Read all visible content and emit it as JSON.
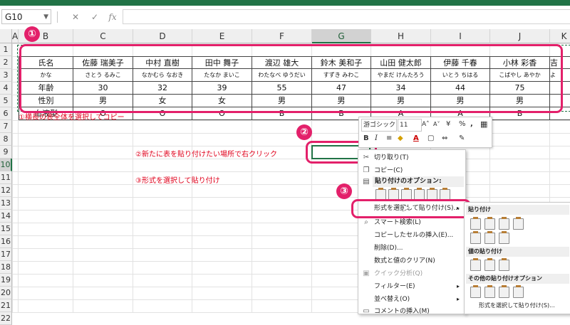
{
  "formula_bar": {
    "name_box": "G10",
    "cancel": "✕",
    "enter": "✓",
    "fx": "fx"
  },
  "columns": [
    "A",
    "B",
    "C",
    "D",
    "E",
    "F",
    "G",
    "H",
    "I",
    "J",
    "K"
  ],
  "rows": [
    "1",
    "2",
    "3",
    "4",
    "5",
    "6",
    "7",
    "8",
    "9",
    "10",
    "11",
    "12",
    "13",
    "14",
    "15",
    "16",
    "17",
    "18",
    "19",
    "20",
    "21",
    "22"
  ],
  "table": [
    [
      "氏名",
      "佐藤 瑞美子",
      "中村 直樹",
      "田中 舞子",
      "渡辺 雄大",
      "鈴木 美和子",
      "山田 健太郎",
      "伊藤 千春",
      "小林 彩香",
      "吉"
    ],
    [
      "かな",
      "さとう るみこ",
      "なかむら なおき",
      "たなか まいこ",
      "わたなべ ゆうだい",
      "すずき みわこ",
      "やまだ けんたろう",
      "いとう ちはる",
      "こばやし あやか",
      "よ"
    ],
    [
      "年齢",
      "30",
      "32",
      "39",
      "55",
      "47",
      "34",
      "44",
      "75",
      ""
    ],
    [
      "性別",
      "男",
      "女",
      "女",
      "男",
      "男",
      "男",
      "男",
      "男",
      ""
    ],
    [
      "血液型",
      "O",
      "O",
      "O",
      "B",
      "B",
      "A",
      "A",
      "B",
      ""
    ]
  ],
  "steps": {
    "n1": "①",
    "n2": "②",
    "n3": "③",
    "s1": "①横長の表全体を選択してコピー",
    "s2": "②新たに表を貼り付けたい場所で右クリック",
    "s3": "③形式を選択して貼り付け"
  },
  "mini_toolbar": {
    "font": "游ゴシック",
    "size": "11",
    "bold": "B",
    "italic": "I",
    "inc": "A˄",
    "dec": "A˅",
    "currency": "¥",
    "percent": "%",
    "comma": ","
  },
  "context_menu": {
    "cut": "切り取り(T)",
    "copy": "コピー(C)",
    "paste_options": "貼り付けのオプション:",
    "paste_special": "形式を選択して貼り付け(S)...",
    "smart_lookup": "スマート検索(L)",
    "insert_copied": "コピーしたセルの挿入(E)...",
    "delete": "削除(D)...",
    "clear": "数式と値のクリア(N)",
    "quick_analysis": "クイック分析(Q)",
    "filter": "フィルター(E)",
    "sort": "並べ替え(O)",
    "insert_comment": "コメントの挿入(M)"
  },
  "submenu": {
    "paste": "貼り付け",
    "paste_values": "値の貼り付け",
    "other_paste": "その他の貼り付けオプション",
    "paste_special": "形式を選択して貼り付け(S)..."
  },
  "colors": {
    "excel_green": "#217346",
    "highlight": "#e3206a",
    "note_red": "#e0001b"
  }
}
